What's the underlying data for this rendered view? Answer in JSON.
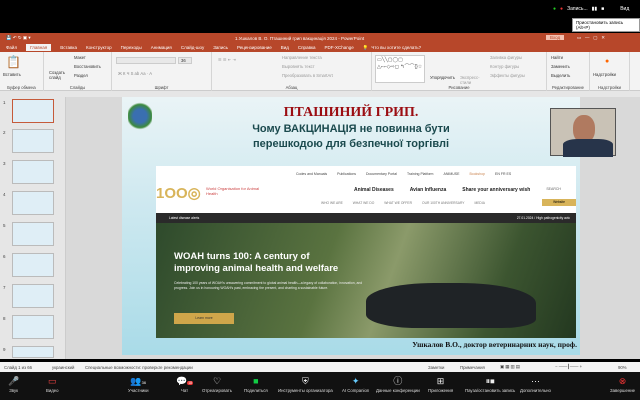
{
  "zoom_top": {
    "recording": "Запись...",
    "view": "Вид",
    "tooltip": "Приостановить запись (Alt+P)"
  },
  "ppt": {
    "title": "1.Ушкалов В. О. Пташиний грип вакцинація 2024 - PowerPoint",
    "signin": "Вход",
    "tabs": [
      "Файл",
      "Главная",
      "Вставка",
      "Конструктор",
      "Переходы",
      "Анимация",
      "Слайд-шоу",
      "Запись",
      "Рецензирование",
      "Вид",
      "Справка",
      "PDF-XChange"
    ],
    "tell_me": "Что вы хотите сделать?",
    "ribbon": {
      "paste": "Вставить",
      "clipboard": "Буфер обмена",
      "new_slide": "Создать слайд",
      "layout": "Макет",
      "reset": "Восстановить",
      "section": "Раздел",
      "slides": "Слайды",
      "font_size": "36",
      "font": "Шрифт",
      "text_dir": "Направление текста",
      "align_text": "Выровнять текст",
      "smartart": "Преобразовать в SmartArt",
      "paragraph": "Абзац",
      "arrange": "Упорядочить",
      "quick_styles": "Экспресс-стили",
      "fill": "Заливка фигуры",
      "outline": "Контур фигуры",
      "effects": "Эффекты фигуры",
      "drawing": "Рисование",
      "find": "Найти",
      "replace": "Заменить",
      "select": "Выделить",
      "editing": "Редактирование",
      "addins": "Надстройки",
      "addins_group": "Надстройки"
    }
  },
  "slide": {
    "title": "ПТАШИНИЙ ГРИП.",
    "subtitle1": "Чому  ВАКЦИНАЦІЯ   не  повинна  бути",
    "subtitle2": "перешкодою  для  безпечної  торгівлі",
    "author": "Ушкалов В.О., доктор ветеринарних наук, проф.",
    "web": {
      "top_links": [
        "Codes and Manuals",
        "Publications",
        "Documentary Portal",
        "Training Platform",
        "ANIMUSE",
        "Bookshop"
      ],
      "langs": "EN  FR  ES",
      "org": "World Organisation for Animal Health",
      "nav_main": [
        "Animal Diseases",
        "Avian Influenza",
        "Share your anniversary wish"
      ],
      "search": "SEARCH",
      "nav_sub": [
        "WHO WE ARE",
        "WHAT WE DO",
        "WHAT WE OFFER",
        "OUR 100TH ANNIVERSARY",
        "MEDIA"
      ],
      "donate": "Website",
      "alert_label": "Latest disease alerts",
      "alert_text": "27.01.2024  /  High pathogenicity avic",
      "hero_title1": "WOAH turns 100: A century of",
      "hero_title2": "improving animal health and welfare",
      "hero_text": "Celebrating 100 years of WOAH's unwavering commitment to global animal health—a legacy of collaboration, innovation, and progress. Join us in honouring WOAH's past, embracing the present, and charting a sustainable future.",
      "learn_more": "Learn more"
    }
  },
  "thumbs": [
    "1",
    "2",
    "3",
    "4",
    "5",
    "6",
    "7",
    "8",
    "9"
  ],
  "status": {
    "slide": "Слайд 1 из 66",
    "lang": "украинский",
    "accessibility": "Специальные возможности: проверьте рекомендации",
    "notes": "Заметки",
    "comments": "Примечания",
    "zoom": "90%"
  },
  "zoom_bar": {
    "audio": "Звук",
    "video": "Видео",
    "participants": "Участники",
    "participants_count": "36",
    "chat": "Чат",
    "chat_badge": "18",
    "react": "Отреагировать",
    "share": "Поделиться",
    "host_tools": "Инструменты организатора",
    "ai": "AI Companion",
    "info": "Данные конференции",
    "apps": "Приложения",
    "pause_rec": "Пауза/остановить запись",
    "more": "Дополнительно",
    "end": "Завершение"
  }
}
